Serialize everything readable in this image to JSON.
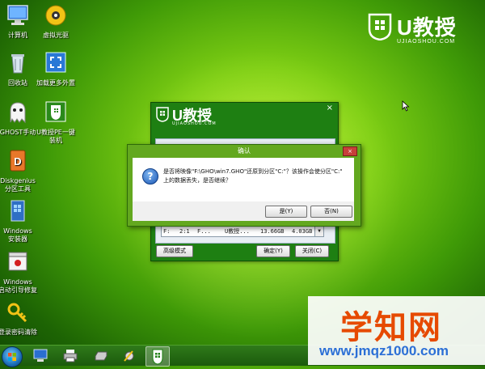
{
  "desktop_icons": [
    {
      "label": "计算机",
      "icon": "computer-icon"
    },
    {
      "label": "虚拟光驱",
      "icon": "virtual-drive-icon"
    },
    {
      "label": "回收站",
      "icon": "recycle-bin-icon"
    },
    {
      "label": "加载更多外置",
      "icon": "load-more-icon"
    },
    {
      "label": "GHOST手动",
      "icon": "ghost-icon"
    },
    {
      "label": "U教授PE一键\n装机",
      "icon": "ujiaoshou-install-icon"
    },
    {
      "label": "Diskgenius\n分区工具",
      "icon": "diskgenius-icon"
    },
    {
      "label": "Windows\n安装器",
      "icon": "windows-installer-icon"
    },
    {
      "label": "Windows\n启动引导修复",
      "icon": "boot-repair-icon"
    },
    {
      "label": "登录密码清除",
      "icon": "key-icon"
    }
  ],
  "brand": {
    "name": "U教授",
    "url": "UJIAOSHOU.COM"
  },
  "tool_window": {
    "logo_name": "U教授",
    "logo_url": "UJIAOSHOU.COM",
    "close": "×",
    "partition_row": {
      "col1": "F:",
      "col2": "2:1",
      "col3": "F...",
      "col4": "U教授...",
      "col5": "13.66GB",
      "col6": "4.03GB"
    },
    "advanced_button": "高级模式",
    "ok_button": "确定(Y)",
    "close_button": "关闭(C)"
  },
  "dialog": {
    "title": "确认",
    "close": "×",
    "message_line1": "是否将映像\"F:\\GHO\\win7.GHO\"还原到分区\"C:\"？该操作会使分区\"C:\"",
    "message_line2": "上的数据丢失，是否继续？",
    "yes_button": "是(Y)",
    "no_button": "否(N)"
  },
  "taskbar": {
    "items": [
      "start-orb-icon",
      "computer-icon",
      "printer-icon",
      "drive-icon",
      "tools-icon",
      "ujiaoshou-app-icon"
    ]
  },
  "watermark": {
    "big": "学知网",
    "small": "www.jmqz1000.com"
  }
}
